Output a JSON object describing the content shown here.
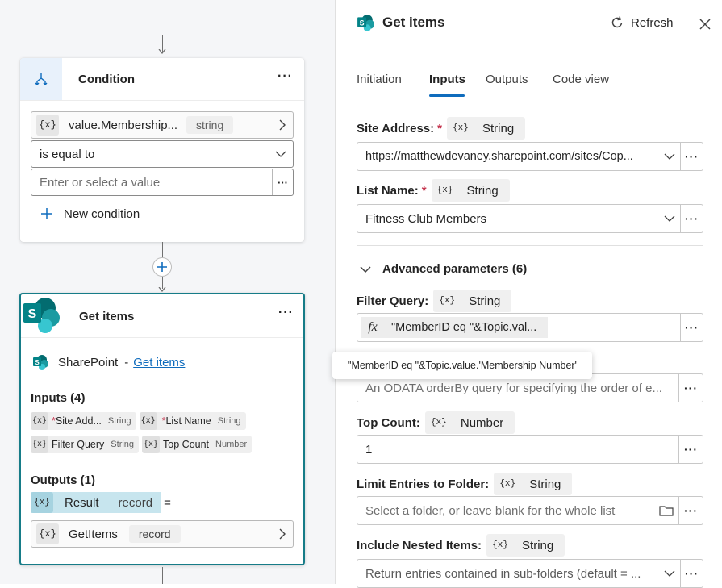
{
  "canvas": {
    "condition": {
      "title": "Condition",
      "variable": "value.Membership...",
      "variable_type": "string",
      "operator": "is equal to",
      "value_placeholder": "Enter or select a value",
      "new_condition_label": "New condition"
    },
    "get_items": {
      "title": "Get items",
      "connector_name": "SharePoint",
      "separator": "-",
      "action_link": "Get items",
      "inputs_heading": "Inputs (4)",
      "inputs": [
        {
          "label": "Site Add...",
          "required": true,
          "type": "String"
        },
        {
          "label": "List Name",
          "required": true,
          "type": "String"
        },
        {
          "label": "Filter Query",
          "required": false,
          "type": "String"
        },
        {
          "label": "Top Count",
          "required": false,
          "type": "Number"
        }
      ],
      "outputs_heading": "Outputs (1)",
      "output_name": "Result",
      "output_type": "record",
      "equals_sign": "=",
      "assign_var": "GetItems",
      "assign_type": "record"
    },
    "var_symbol": "{x}",
    "required_mark": "*"
  },
  "panel": {
    "title": "Get items",
    "refresh_label": "Refresh",
    "tabs": [
      "Initiation",
      "Inputs",
      "Outputs",
      "Code view"
    ],
    "active_tab": "Inputs",
    "var_symbol": "{x}",
    "fx_symbol": "fx",
    "required_mark": "*",
    "site_address": {
      "label": "Site Address:",
      "type": "String",
      "value": "https://matthewdevaney.sharepoint.com/sites/Cop..."
    },
    "list_name": {
      "label": "List Name:",
      "type": "String",
      "value": "Fitness Club Members"
    },
    "advanced_label": "Advanced parameters (6)",
    "filter_query": {
      "label": "Filter Query:",
      "type": "String",
      "value": "\"MemberID eq \"&Topic.val..."
    },
    "tooltip": "\"MemberID eq \"&Topic.value.'Membership Number'",
    "order_by": {
      "placeholder": "An ODATA orderBy query for specifying the order of e..."
    },
    "top_count": {
      "label": "Top Count:",
      "type": "Number",
      "value": "1"
    },
    "limit_folder": {
      "label": "Limit Entries to Folder:",
      "type": "String",
      "placeholder": "Select a folder, or leave blank for the whole list"
    },
    "nested_items": {
      "label": "Include Nested Items:",
      "type": "String",
      "placeholder": "Return entries contained in sub-folders (default = ..."
    }
  },
  "colors": {
    "accent": "#0f6cbd",
    "sharepoint_teal": "#038387",
    "selected_border": "#167c88",
    "result_chip": "#c7e5ee"
  }
}
